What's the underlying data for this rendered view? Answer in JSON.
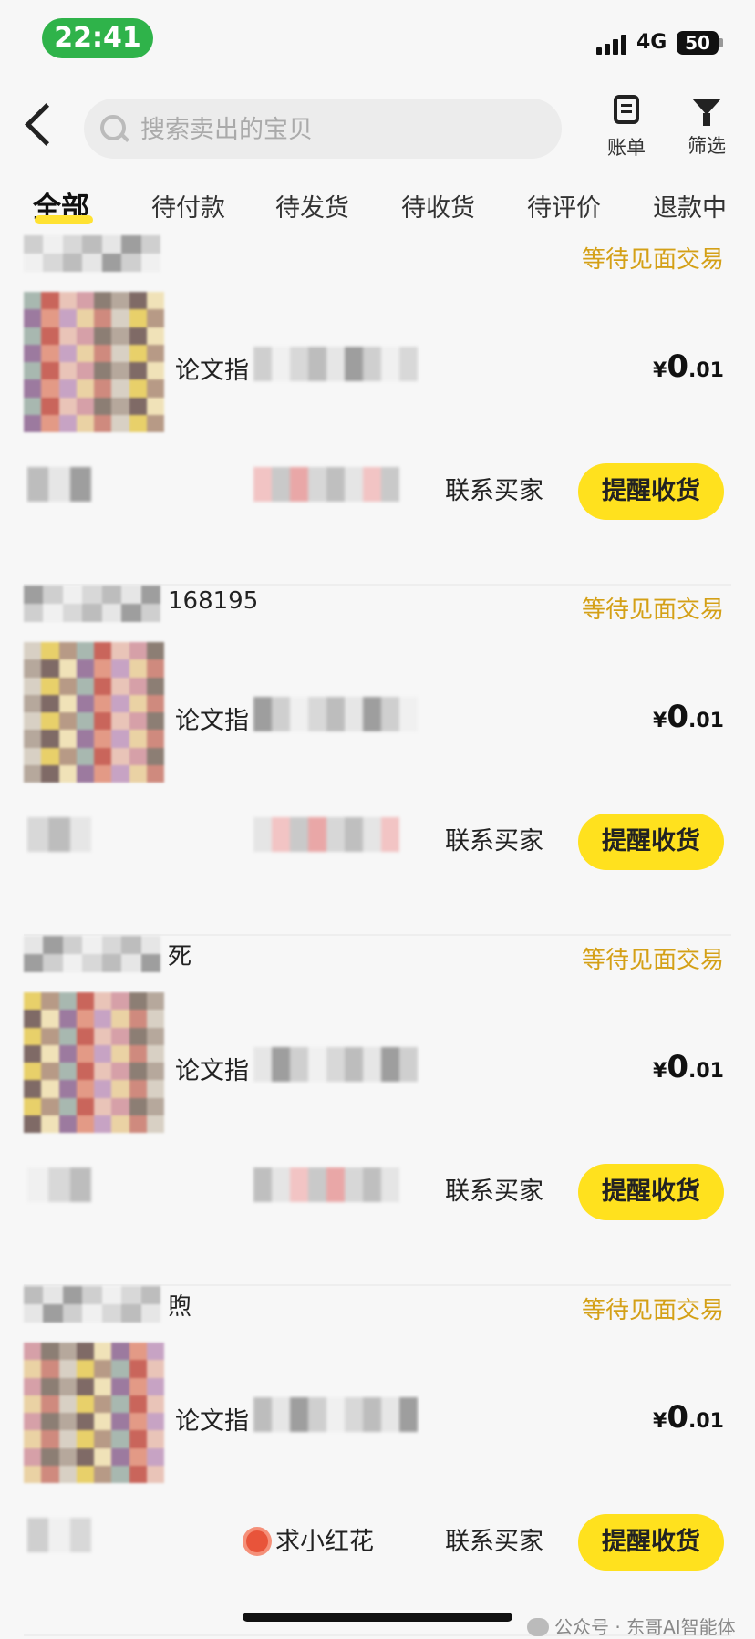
{
  "status_bar": {
    "time": "22:41",
    "network": "4G",
    "battery": "50"
  },
  "header": {
    "search_placeholder": "搜索卖出的宝贝",
    "bill_label": "账单",
    "filter_label": "筛选"
  },
  "tabs": [
    {
      "label": "全部",
      "active": true
    },
    {
      "label": "待付款"
    },
    {
      "label": "待发货"
    },
    {
      "label": "待收货"
    },
    {
      "label": "待评价"
    },
    {
      "label": "退款中"
    }
  ],
  "orders": [
    {
      "buyer": "",
      "status": "等待见面交易",
      "title": "论文指",
      "price_symbol": "¥",
      "price_int": "0",
      "price_dec": ".01",
      "contact": "联系买家",
      "remind": "提醒收货"
    },
    {
      "buyer": "168195",
      "status": "等待见面交易",
      "title": "论文指",
      "price_symbol": "¥",
      "price_int": "0",
      "price_dec": ".01",
      "contact": "联系买家",
      "remind": "提醒收货"
    },
    {
      "buyer": "死",
      "status": "等待见面交易",
      "title": "论文指",
      "price_symbol": "¥",
      "price_int": "0",
      "price_dec": ".01",
      "contact": "联系买家",
      "remind": "提醒收货"
    },
    {
      "buyer": "煦",
      "status": "等待见面交易",
      "title": "论文指",
      "price_symbol": "¥",
      "price_int": "0",
      "price_dec": ".01",
      "contact": "联系买家",
      "remind": "提醒收货",
      "extra": "求小红花"
    }
  ],
  "watermark": "公众号 · 东哥AI智能体",
  "colors": {
    "accent": "#ffe11e",
    "status": "#d4a017",
    "time_pill": "#2fb34a"
  }
}
